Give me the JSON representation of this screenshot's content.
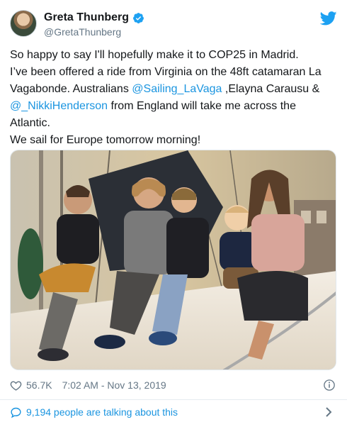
{
  "user": {
    "display_name": "Greta Thunberg",
    "handle": "@GretaThunberg",
    "verified": true
  },
  "tweet": {
    "line1": "So happy to say I'll hopefully make it to COP25 in Madrid.",
    "line2": "I’ve been offered a ride from Virginia on the 48ft catamaran La",
    "line3_a": "Vagabonde. Australians ",
    "line3_mention": "@Sailing_LaVaga",
    "line3_b": " ,Elayna Carausu &",
    "line4_mention": "@_NikkiHenderson",
    "line4_b": " from England will take me across the",
    "line5": "Atlantic.",
    "line6": "We sail for Europe tomorrow morning!"
  },
  "footer": {
    "likes": "56.7K",
    "timestamp": "7:02 AM - Nov 13, 2019",
    "talking": "9,194 people are talking about this"
  },
  "colors": {
    "link": "#1b95e0",
    "muted": "#657786",
    "twitter_blue": "#1da1f2"
  },
  "icons": [
    "verified-badge-icon",
    "twitter-bird-icon",
    "heart-icon",
    "info-icon",
    "speech-bubble-icon",
    "chevron-right-icon"
  ]
}
